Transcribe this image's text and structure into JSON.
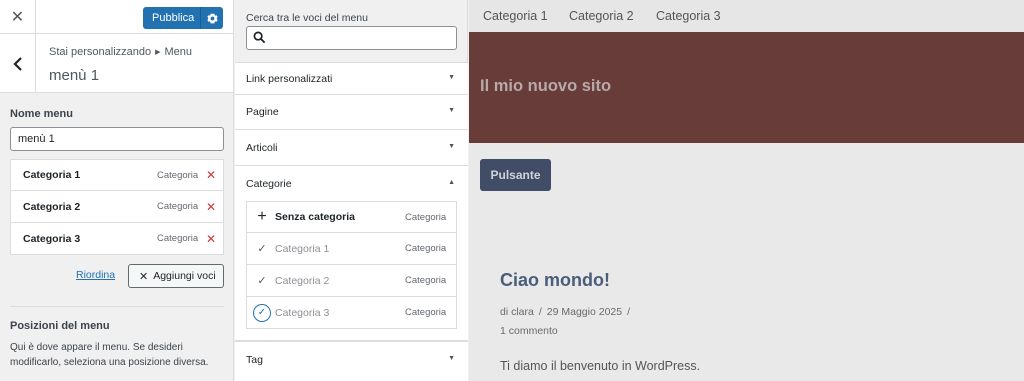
{
  "header": {
    "close_icon": "close-icon",
    "publish_label": "Pubblica",
    "publish_settings_icon": "gear-icon"
  },
  "panel": {
    "back_icon": "chevron-left-icon",
    "breadcrumb_prefix": "Stai personalizzando",
    "breadcrumb_section": "Menu",
    "title": "menù 1"
  },
  "menu_editor": {
    "name_label": "Nome menu",
    "name_value": "menù 1",
    "items": [
      {
        "title": "Categoria 1",
        "type": "Categoria"
      },
      {
        "title": "Categoria 2",
        "type": "Categoria"
      },
      {
        "title": "Categoria 3",
        "type": "Categoria"
      }
    ],
    "reorder_label": "Riordina",
    "add_items_label": "Aggiungi voci",
    "locations_title": "Posizioni del menu",
    "locations_description": "Qui è dove appare il menu. Se desideri modificarlo, seleziona una posizione diversa."
  },
  "available_items": {
    "search_label": "Cerca tra le voci del menu",
    "search_value": "",
    "sections": {
      "custom_links": "Link personalizzati",
      "pages": "Pagine",
      "posts": "Articoli",
      "categories": "Categorie",
      "tags": "Tag"
    },
    "category_items": [
      {
        "title": "Senza categoria",
        "type": "Categoria",
        "state": "add"
      },
      {
        "title": "Categoria 1",
        "type": "Categoria",
        "state": "added"
      },
      {
        "title": "Categoria 2",
        "type": "Categoria",
        "state": "added"
      },
      {
        "title": "Categoria 3",
        "type": "Categoria",
        "state": "just-added"
      }
    ]
  },
  "preview": {
    "nav": [
      "Categoria 1",
      "Categoria 2",
      "Categoria 3"
    ],
    "site_title": "Il mio nuovo sito",
    "button_label": "Pulsante",
    "post": {
      "title": "Ciao mondo!",
      "author": "di clara",
      "date": "29 Maggio 2025",
      "comments": "1 commento",
      "excerpt": "Ti diamo il benvenuto in WordPress."
    }
  },
  "colors": {
    "accent": "#2271b1",
    "hero_bg": "#673c39",
    "remove": "#d63638"
  }
}
